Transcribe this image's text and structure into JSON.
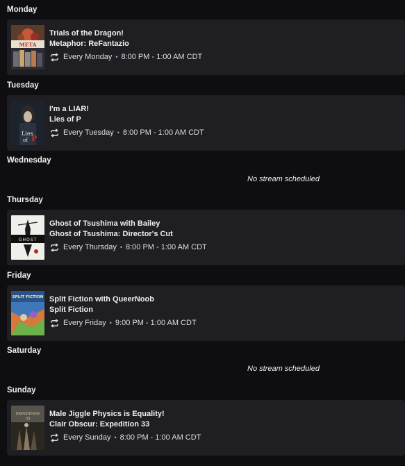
{
  "schedule": {
    "monday": {
      "day": "Monday",
      "title": "Trials of the Dragon!",
      "game": "Metaphor: ReFantazio",
      "recurrence": "Every Monday",
      "time": "8:00 PM - 1:00 AM CDT",
      "thumb_text": "METAPHOR"
    },
    "tuesday": {
      "day": "Tuesday",
      "title": "I'm a LIAR!",
      "game": "Lies of P",
      "recurrence": "Every Tuesday",
      "time": "8:00 PM - 1:00 AM CDT",
      "thumb_text": "Lies of P"
    },
    "wednesday": {
      "day": "Wednesday",
      "empty": "No stream scheduled"
    },
    "thursday": {
      "day": "Thursday",
      "title": "Ghost of Tsushima with Bailey",
      "game": "Ghost of Tsushima: Director's Cut",
      "recurrence": "Every Thursday",
      "time": "8:00 PM - 1:00 AM CDT",
      "thumb_text": "GHOST"
    },
    "friday": {
      "day": "Friday",
      "title": "Split Fiction with QueerNoob",
      "game": "Split Fiction",
      "recurrence": "Every Friday",
      "time": "9:00 PM - 1:00 AM CDT",
      "thumb_text": "SPLIT FICTION"
    },
    "saturday": {
      "day": "Saturday",
      "empty": "No stream scheduled"
    },
    "sunday": {
      "day": "Sunday",
      "title": "Male Jiggle Physics is Equality!",
      "game": "Clair Obscur: Expedition 33",
      "recurrence": "Every Sunday",
      "time": "8:00 PM - 1:00 AM CDT",
      "thumb_text": "EXPEDITION 33"
    }
  },
  "colors": {
    "background": "#0e0e10",
    "card": "#1f1f23",
    "text": "#efeff1",
    "muted": "#adadb8"
  },
  "icons": {
    "recurrence": "repeat-icon"
  }
}
